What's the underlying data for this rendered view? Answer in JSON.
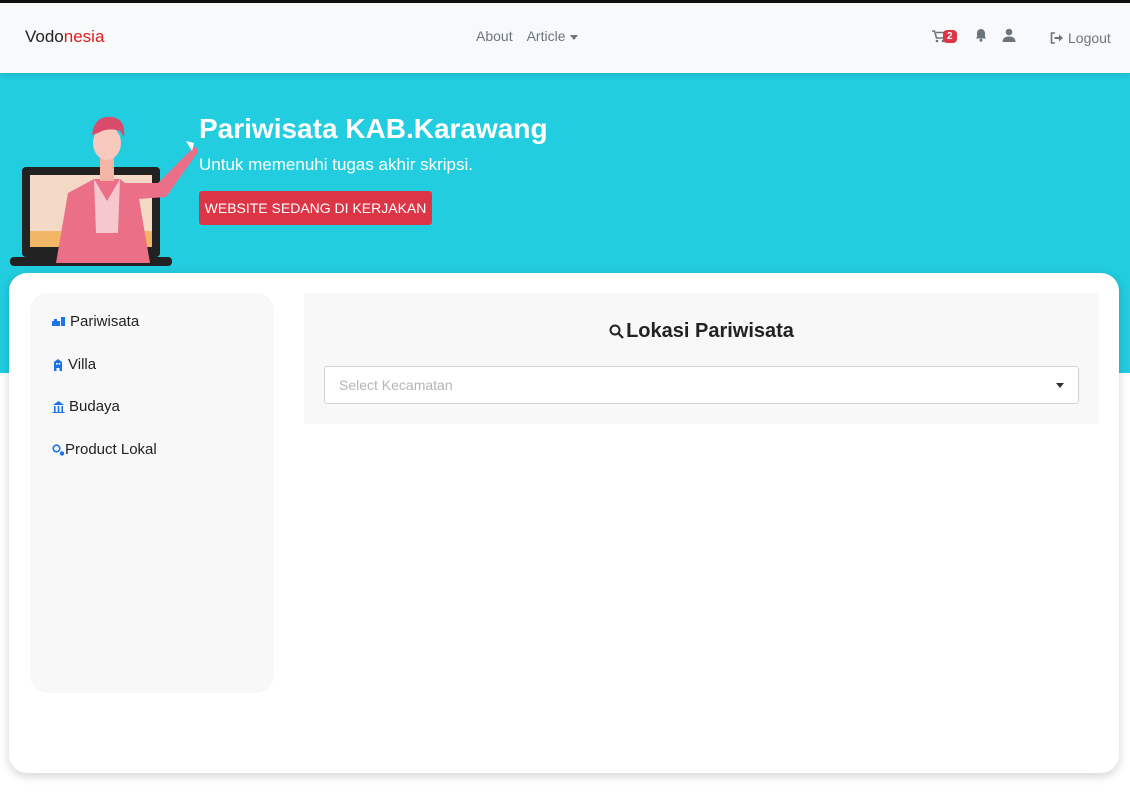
{
  "navbar": {
    "brand_prefix": "Vodo",
    "brand_suffix": "nesia",
    "links": [
      {
        "label": "About"
      },
      {
        "label": "Article"
      }
    ],
    "cart_count": "2",
    "logout_label": "Logout"
  },
  "hero": {
    "title": "Pariwisata KAB.Karawang",
    "subtitle": "Untuk memenuhi tugas akhir skripsi.",
    "button_label": "WEBSITE SEDANG DI KERJAKAN"
  },
  "sidebar": {
    "items": [
      {
        "label": "Pariwisata",
        "icon": "tourism-icon"
      },
      {
        "label": "Villa",
        "icon": "hotel-icon"
      },
      {
        "label": "Budaya",
        "icon": "culture-icon"
      },
      {
        "label": "Product Lokal",
        "icon": "product-icon"
      }
    ]
  },
  "panel": {
    "title": "Lokasi Pariwisata",
    "select_placeholder": "Select Kecamatan"
  },
  "colors": {
    "hero_bg": "#22cde0",
    "accent_red": "#dc3545",
    "brand_red": "#dc1f1f",
    "icon_blue": "#1a73e8"
  }
}
